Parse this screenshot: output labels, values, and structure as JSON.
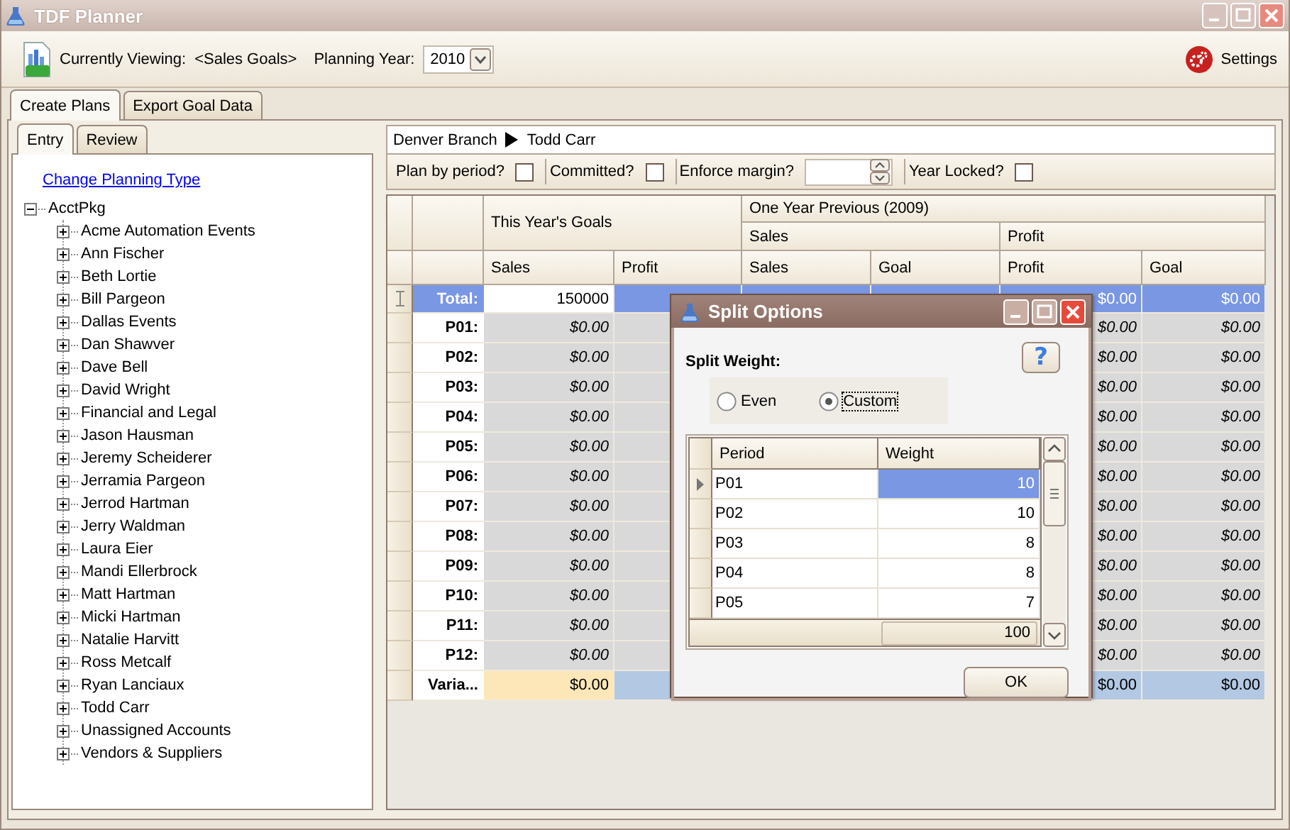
{
  "window": {
    "title": "TDF Planner"
  },
  "toolbar": {
    "viewing_label": "Currently Viewing:",
    "viewing_value": "<Sales Goals>",
    "year_label": "Planning Year:",
    "year_value": "2010",
    "settings": "Settings"
  },
  "main_tabs": [
    {
      "label": "Create Plans",
      "selected": true
    },
    {
      "label": "Export Goal Data",
      "selected": false
    }
  ],
  "side_tabs": [
    {
      "label": "Entry",
      "selected": true
    },
    {
      "label": "Review",
      "selected": false
    }
  ],
  "change_link": "Change Planning Type",
  "tree": {
    "label": "AcctPkg",
    "expanded": true,
    "children": [
      {
        "label": "Acme Automation Events",
        "expanded": false
      },
      {
        "label": "Ann Fischer",
        "expanded": false
      },
      {
        "label": "Beth Lortie",
        "expanded": false
      },
      {
        "label": "Bill Pargeon",
        "expanded": false
      },
      {
        "label": "Dallas Events",
        "expanded": false
      },
      {
        "label": "Dan Shawver",
        "expanded": false
      },
      {
        "label": "Dave Bell",
        "expanded": false
      },
      {
        "label": "David Wright",
        "expanded": false
      },
      {
        "label": "Financial and Legal",
        "expanded": false
      },
      {
        "label": "Jason Hausman",
        "expanded": false
      },
      {
        "label": "Jeremy Scheiderer",
        "expanded": false
      },
      {
        "label": "Jerramia Pargeon",
        "expanded": false
      },
      {
        "label": "Jerrod Hartman",
        "expanded": false
      },
      {
        "label": "Jerry Waldman",
        "expanded": false
      },
      {
        "label": "Laura Eier",
        "expanded": false
      },
      {
        "label": "Mandi Ellerbrock",
        "expanded": false
      },
      {
        "label": "Matt Hartman",
        "expanded": false
      },
      {
        "label": "Micki Hartman",
        "expanded": false
      },
      {
        "label": "Natalie Harvitt",
        "expanded": false
      },
      {
        "label": "Ross Metcalf",
        "expanded": false
      },
      {
        "label": "Ryan Lanciaux",
        "expanded": false
      },
      {
        "label": "Todd Carr",
        "expanded": false
      },
      {
        "label": "Unassigned Accounts",
        "expanded": false
      },
      {
        "label": "Vendors & Suppliers",
        "expanded": false
      }
    ]
  },
  "breadcrumb": [
    "Denver Branch",
    "Todd Carr"
  ],
  "options": [
    {
      "kind": "checkbox",
      "label": "Plan by period?",
      "checked": false
    },
    {
      "kind": "checkbox",
      "label": "Committed?",
      "checked": false
    },
    {
      "kind": "spinner",
      "label": "Enforce margin?"
    },
    {
      "kind": "checkbox",
      "label": "Year Locked?",
      "checked": false
    }
  ],
  "grid": {
    "this_year": "This Year's Goals",
    "previous": "One Year Previous (2009)",
    "previous_groups": [
      "Sales",
      "Profit"
    ],
    "columns": [
      "Sales",
      "Profit",
      "Sales",
      "Goal",
      "Profit",
      "Goal"
    ],
    "rows": [
      {
        "label": "Total:",
        "kind": "total",
        "current": true,
        "cells": [
          "150000",
          null,
          null,
          null,
          "$0.00",
          "$0.00"
        ]
      },
      {
        "label": "P01:",
        "kind": "period",
        "current": false,
        "cells": [
          "$0.00",
          null,
          null,
          null,
          "$0.00",
          "$0.00"
        ]
      },
      {
        "label": "P02:",
        "kind": "period",
        "current": false,
        "cells": [
          "$0.00",
          null,
          null,
          null,
          "$0.00",
          "$0.00"
        ]
      },
      {
        "label": "P03:",
        "kind": "period",
        "current": false,
        "cells": [
          "$0.00",
          null,
          null,
          null,
          "$0.00",
          "$0.00"
        ]
      },
      {
        "label": "P04:",
        "kind": "period",
        "current": false,
        "cells": [
          "$0.00",
          null,
          null,
          null,
          "$0.00",
          "$0.00"
        ]
      },
      {
        "label": "P05:",
        "kind": "period",
        "current": false,
        "cells": [
          "$0.00",
          null,
          null,
          null,
          "$0.00",
          "$0.00"
        ]
      },
      {
        "label": "P06:",
        "kind": "period",
        "current": false,
        "cells": [
          "$0.00",
          null,
          null,
          null,
          "$0.00",
          "$0.00"
        ]
      },
      {
        "label": "P07:",
        "kind": "period",
        "current": false,
        "cells": [
          "$0.00",
          null,
          null,
          null,
          "$0.00",
          "$0.00"
        ]
      },
      {
        "label": "P08:",
        "kind": "period",
        "current": false,
        "cells": [
          "$0.00",
          null,
          null,
          null,
          "$0.00",
          "$0.00"
        ]
      },
      {
        "label": "P09:",
        "kind": "period",
        "current": false,
        "cells": [
          "$0.00",
          null,
          null,
          null,
          "$0.00",
          "$0.00"
        ]
      },
      {
        "label": "P10:",
        "kind": "period",
        "current": false,
        "cells": [
          "$0.00",
          null,
          null,
          null,
          "$0.00",
          "$0.00"
        ]
      },
      {
        "label": "P11:",
        "kind": "period",
        "current": false,
        "cells": [
          "$0.00",
          null,
          null,
          null,
          "$0.00",
          "$0.00"
        ]
      },
      {
        "label": "P12:",
        "kind": "period",
        "current": false,
        "cells": [
          "$0.00",
          null,
          null,
          null,
          "$0.00",
          "$0.00"
        ]
      },
      {
        "label": "Varia...",
        "kind": "variance",
        "current": false,
        "cells": [
          "$0.00",
          null,
          null,
          null,
          "$0.00",
          "$0.00"
        ]
      }
    ]
  },
  "dialog": {
    "title": "Split Options",
    "heading": "Split Weight:",
    "help": "?",
    "options": [
      {
        "label": "Even",
        "selected": false
      },
      {
        "label": "Custom",
        "selected": true
      }
    ],
    "columns": [
      "Period",
      "Weight"
    ],
    "rows": [
      {
        "period": "P01",
        "weight": "10",
        "selected": true
      },
      {
        "period": "P02",
        "weight": "10",
        "selected": false
      },
      {
        "period": "P03",
        "weight": "8",
        "selected": false
      },
      {
        "period": "P04",
        "weight": "8",
        "selected": false
      },
      {
        "period": "P05",
        "weight": "7",
        "selected": false
      }
    ],
    "total": "100",
    "ok": "OK"
  }
}
